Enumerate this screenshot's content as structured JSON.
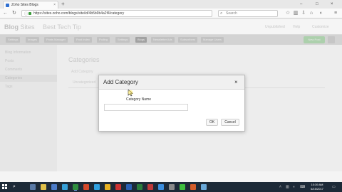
{
  "browser": {
    "tab_title": "Zoho Sites Blogs",
    "tab_close": "×",
    "new_tab": "+",
    "url": "https://sites.zoho.com/blogs/site/id/4b5b9b4a2f4/category",
    "search_placeholder": "Search",
    "window_controls": [
      "–",
      "□",
      "×"
    ]
  },
  "app": {
    "logo_main": "Blog",
    "logo_sub": "Sites",
    "blog_title": "Best Tech Tip",
    "header_right": [
      "Unpublished",
      "Help",
      "Customize"
    ],
    "menu": [
      "Settings",
      "Images",
      "Posts Manager",
      "Post Index",
      "Polling",
      "Settings",
      "Blogs",
      "Newsletter Ads",
      "Subscribers",
      "Manage Users"
    ],
    "active_menu_index": 6,
    "new_post_label": "New Post",
    "sidebar": [
      "Blog Information",
      "Posts",
      "Comments",
      "Categories",
      "Tags"
    ],
    "active_sidebar_index": 3,
    "page_heading": "Categories",
    "add_category_link": "Add Category",
    "category_column": "Categories",
    "category_row": "Uncategorized"
  },
  "modal": {
    "title": "Add Category",
    "close_glyph": "×",
    "field_label": "Category Name",
    "field_value": "",
    "field_placeholder": "",
    "ok_label": "OK",
    "cancel_label": "Cancel"
  },
  "taskbar": {
    "search_glyph": "⌕",
    "app_colors": [
      "#5a7aa6",
      "#e0c04a",
      "#4c7cc9",
      "#36a0d8",
      "#2f8f3f",
      "#d4492b",
      "#2fa0e0",
      "#e6b022",
      "#cc3333",
      "#2b5fb3",
      "#2a7d3c",
      "#bf3a3a",
      "#3c8ede",
      "#8a8a8a",
      "#3fbf3f",
      "#d45d2a",
      "#6aa9d9"
    ],
    "active_app_index": 4,
    "time": "10:39 AM",
    "date": "6/15/2017"
  },
  "colors": {
    "taskbar_bg": "#1d2a38",
    "modal_header_bg": "#f0f0f0",
    "accent_green": "#b4d9b4"
  }
}
